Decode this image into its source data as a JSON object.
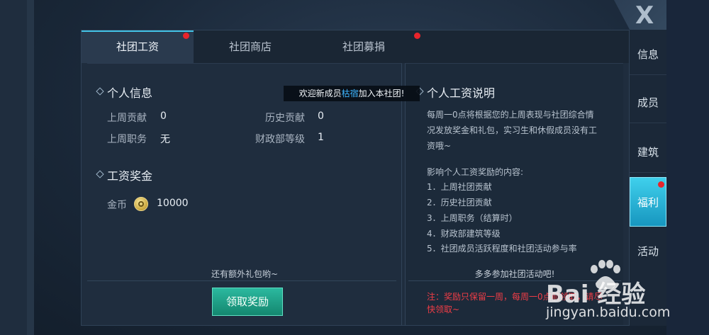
{
  "tabs": [
    {
      "label": "社团工资",
      "active": true,
      "badge": true
    },
    {
      "label": "社团商店",
      "active": false,
      "badge": false
    },
    {
      "label": "社团募捐",
      "active": false,
      "badge": true
    }
  ],
  "personal": {
    "title": "个人信息",
    "last_week_contribution_label": "上周贡献",
    "last_week_contribution_value": "0",
    "history_contribution_label": "历史贡献",
    "history_contribution_value": "0",
    "last_week_role_label": "上周职务",
    "last_week_role_value": "无",
    "finance_level_label": "财政部等级",
    "finance_level_value": "1"
  },
  "salary": {
    "title": "工资奖金",
    "gold_label": "金币",
    "gold_value": "10000",
    "extra_hint": "还有额外礼包哟~",
    "claim_button": "领取奖励"
  },
  "explain": {
    "title": "个人工资说明",
    "para_line1": "每周一0点将根据您的上周表现与社团综合情",
    "para_line2": "况发放奖金和礼包，实习生和休假成员没有工",
    "para_line3": "资哦~",
    "factors_title": "影响个人工资奖励的内容:",
    "factors": [
      "1．上周社团贡献",
      "2．历史社团贡献",
      "3．上周职务（结算时）",
      "4．财政部建筑等级",
      "5．社团成员活跃程度和社团活动参与率"
    ],
    "encourage": "多多参加社团活动吧!",
    "note_line1": "注：奖励只保留一周，每周一0点前领取，请尽",
    "note_line2": "快领取~"
  },
  "toast": {
    "prefix": "欢迎新成员",
    "name": "枯宿",
    "suffix": "加入本社团!"
  },
  "side_nav": [
    {
      "label": "信息",
      "active": false
    },
    {
      "label": "成员",
      "active": false
    },
    {
      "label": "建筑",
      "active": false
    },
    {
      "label": "福利",
      "active": true
    },
    {
      "label": "活动",
      "active": false
    }
  ],
  "close_label": "X",
  "watermark": {
    "logo": "Bai 经验",
    "url": "jingyan.baidu.com"
  },
  "colors": {
    "accent": "#42c2e6",
    "badge": "#e8242b",
    "button": "#1fa38a",
    "note": "#ef3d46",
    "toast_highlight": "#3fb6ff"
  }
}
